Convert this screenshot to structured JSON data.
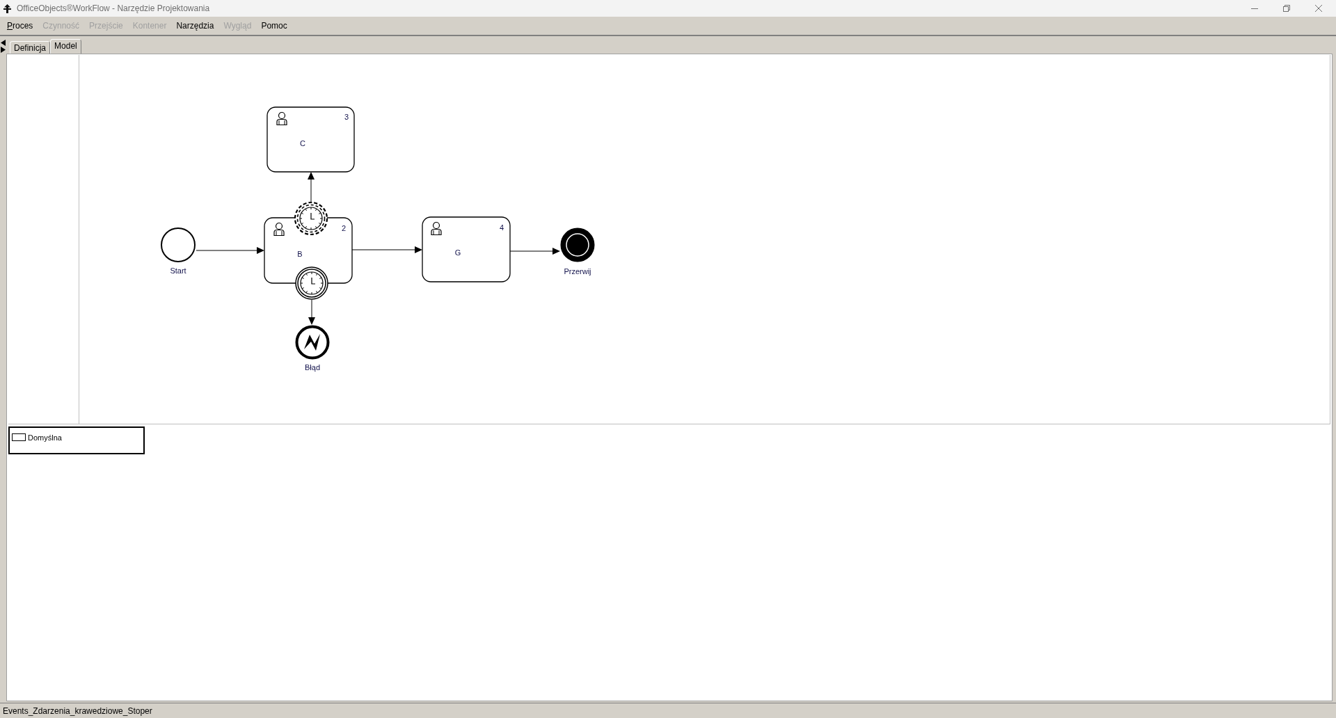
{
  "window": {
    "title": "OfficeObjects®WorkFlow - Narzędzie Projektowania"
  },
  "menu": [
    {
      "label": "Proces",
      "disabled": false,
      "access_key_underlined": true
    },
    {
      "label": "Czynność",
      "disabled": true,
      "access_key_underlined": false
    },
    {
      "label": "Przejście",
      "disabled": true,
      "access_key_underlined": false
    },
    {
      "label": "Kontener",
      "disabled": true,
      "access_key_underlined": false
    },
    {
      "label": "Narzędzia",
      "disabled": false,
      "access_key_underlined": false
    },
    {
      "label": "Wygląd",
      "disabled": true,
      "access_key_underlined": false
    },
    {
      "label": "Pomoc",
      "disabled": false,
      "access_key_underlined": false
    }
  ],
  "tabs": [
    {
      "label": "Definicja",
      "selected": false
    },
    {
      "label": "Model",
      "selected": true
    }
  ],
  "diagram": {
    "nodes": [
      {
        "kind": "user_task",
        "label": "C",
        "number": "3"
      },
      {
        "kind": "start_event",
        "label": "Start"
      },
      {
        "kind": "user_task",
        "label": "B",
        "number": "2",
        "boundary_events": [
          {
            "kind": "timer",
            "interrupting": false
          },
          {
            "kind": "timer",
            "interrupting": true
          }
        ]
      },
      {
        "kind": "user_task",
        "label": "G",
        "number": "4"
      },
      {
        "kind": "terminate_end_event",
        "label": "Przerwij"
      },
      {
        "kind": "error_end_event",
        "label": "Błąd"
      }
    ],
    "flows": [
      {
        "kind": "sequence"
      },
      {
        "kind": "sequence"
      },
      {
        "kind": "sequence"
      },
      {
        "kind": "sequence"
      },
      {
        "kind": "sequence"
      }
    ]
  },
  "lanes": [
    {
      "label": "Domyślna"
    }
  ],
  "status_bar": {
    "text": "Events_Zdarzenia_krawedziowe_Stoper"
  }
}
